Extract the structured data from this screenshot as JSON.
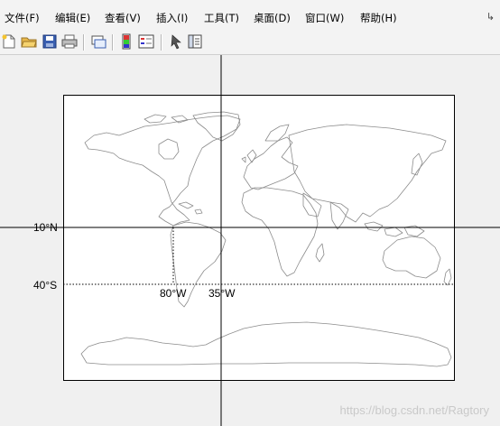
{
  "menu": {
    "items": [
      "文件(F)",
      "编辑(E)",
      "查看(V)",
      "插入(I)",
      "工具(T)",
      "桌面(D)",
      "窗口(W)",
      "帮助(H)"
    ],
    "overflow_icon": "dock-arrow-icon"
  },
  "toolbar": {
    "icons": [
      "new-file-icon",
      "open-folder-icon",
      "save-icon",
      "print-icon",
      "link-plot-icon",
      "colorbar-icon",
      "legend-icon",
      "pointer-icon",
      "property-inspector-icon"
    ]
  },
  "plot": {
    "lat_labels": [
      "10°N",
      "40°S"
    ],
    "lon_labels": [
      "80°W",
      "35°W"
    ],
    "colors": {
      "coastline": "#8c8c8c",
      "line": "#000000",
      "axes_bg": "#ffffff"
    }
  },
  "watermark": "https://blog.csdn.net/Ragtory"
}
